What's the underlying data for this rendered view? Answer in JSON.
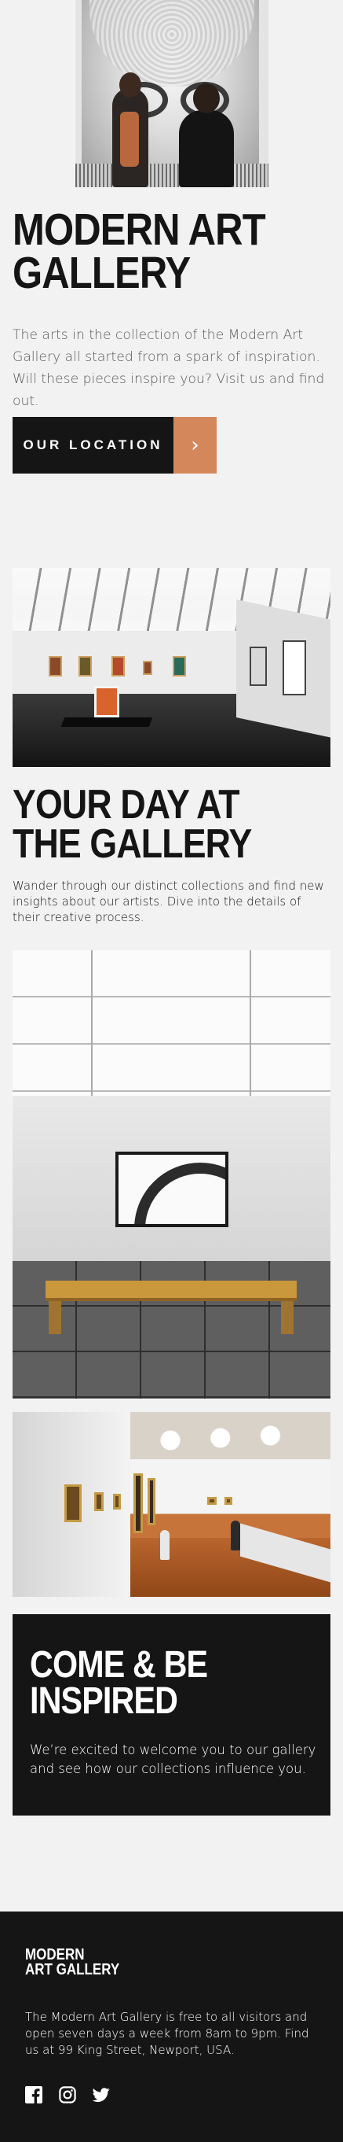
{
  "hero": {
    "title": "MODERN ART GALLERY",
    "text": "The arts in the collection of the Modern Art Gallery all started from a spark of inspiration. Will these pieces inspire you? Visit us and find out.",
    "button_label": "OUR LOCATION",
    "button_arrow": "›"
  },
  "section": {
    "title": "YOUR DAY AT THE GALLERY",
    "text": "Wander through our distinct collections and find new insights about our artists. Dive into the details of their creative process."
  },
  "inspired": {
    "title": "COME & BE INSPIRED",
    "text": "We’re excited to welcome you to our gallery and see how our collections influence you."
  },
  "footer": {
    "logo_line1": "MODERN",
    "logo_line2": "ART GALLERY",
    "info": "The Modern Art Gallery is free to all visitors and open seven days a week from 8am to 9pm. Find us at 99 King Street, Newport, USA."
  },
  "colors": {
    "background": "#f2f2f2",
    "dark": "#151515",
    "accent": "#d5875c",
    "body_text": "#5a5a5a"
  },
  "icons": [
    "facebook-icon",
    "instagram-icon",
    "twitter-icon"
  ]
}
